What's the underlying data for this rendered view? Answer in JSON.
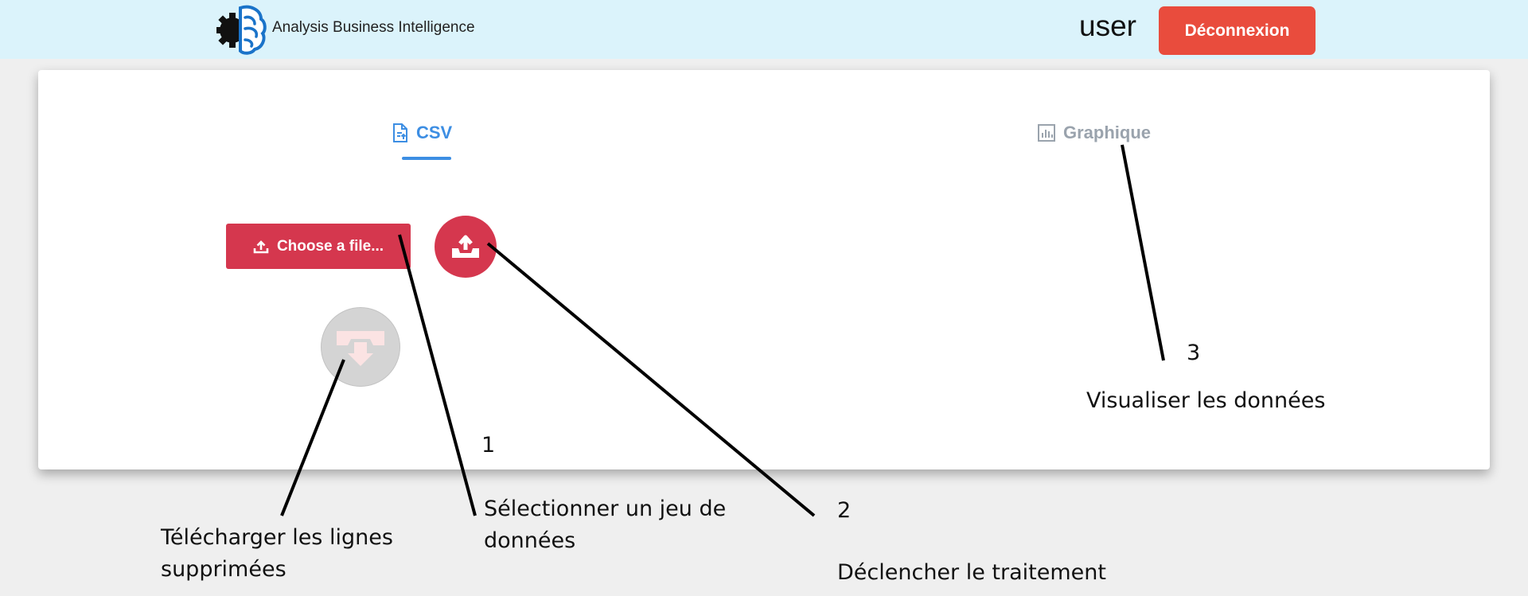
{
  "header": {
    "brand": "Analysis Business Intelligence",
    "username": "user",
    "logout_label": "Déconnexion"
  },
  "tabs": [
    {
      "label": "CSV",
      "icon": "file-upload-icon",
      "active": true
    },
    {
      "label": "Graphique",
      "icon": "bar-chart-icon",
      "active": false
    }
  ],
  "actions": {
    "choose_file_label": "Choose a file...",
    "upload_icon": "upload-tray-icon",
    "download_icon": "download-tray-icon"
  },
  "annotations": [
    {
      "number": "1",
      "text": "Sélectionner un jeu de\ndonnées"
    },
    {
      "number": "2",
      "text": "Déclencher le traitement"
    },
    {
      "number": "3",
      "text": "Visualiser les données"
    },
    {
      "number": "",
      "text": "Télécharger les lignes\nsupprimées"
    }
  ],
  "colors": {
    "header_bg": "#dbf3fb",
    "accent_blue": "#3d8ee3",
    "primary_red": "#d5374e",
    "logout_red": "#e94c3d",
    "disabled_gray": "#d4d4d4"
  }
}
